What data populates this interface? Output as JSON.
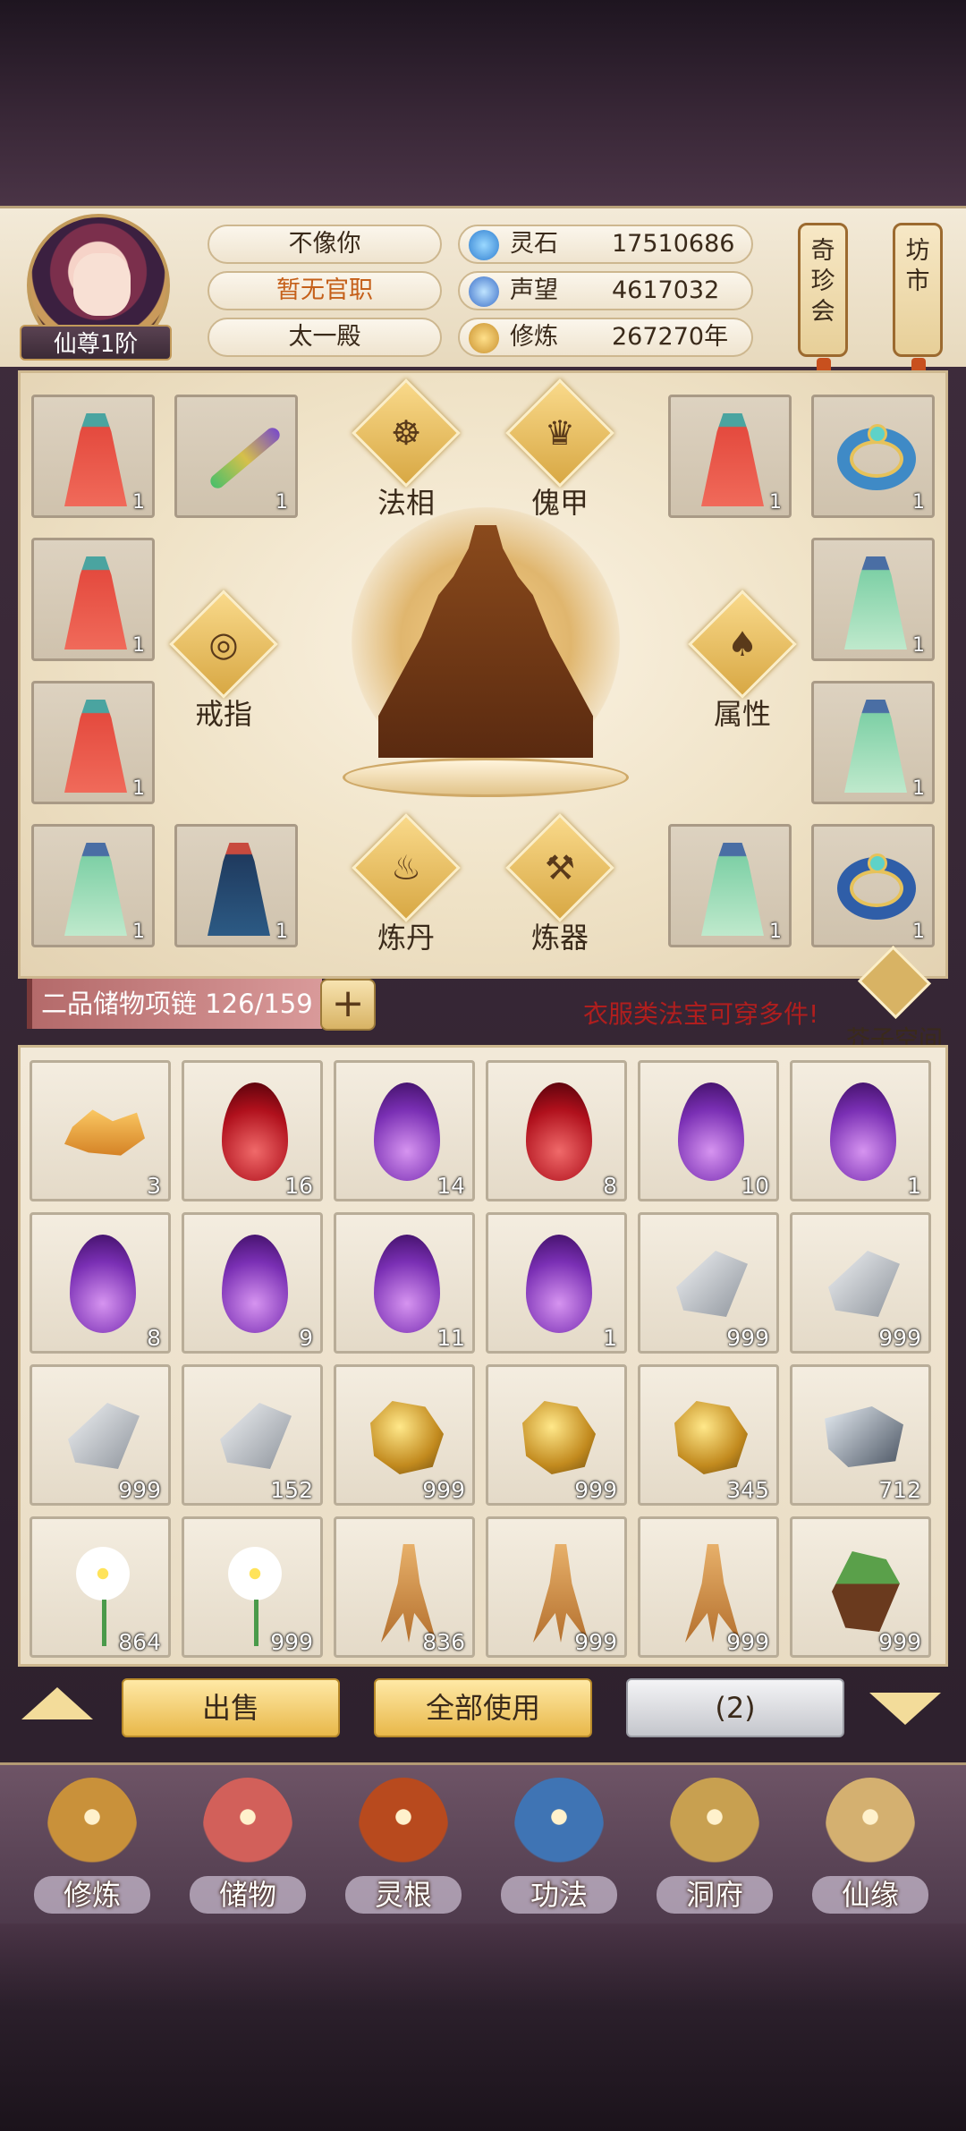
{
  "player": {
    "rank": "仙尊1阶",
    "name": "不像你",
    "official_post": "暂无官职",
    "sect": "太一殿"
  },
  "resources": [
    {
      "icon": "spirit-stone-icon",
      "label": "灵石",
      "value": "17510686"
    },
    {
      "icon": "reputation-icon",
      "label": "声望",
      "value": "4617032"
    },
    {
      "icon": "cultivation-icon",
      "label": "修炼",
      "value": "267270年"
    }
  ],
  "side_buttons": [
    {
      "label": "奇珍会"
    },
    {
      "label": "坊市"
    }
  ],
  "equipment": {
    "left_slots": [
      {
        "item": "red-robe",
        "count": "1"
      },
      {
        "item": "sword",
        "count": "1"
      },
      {
        "item": "red-robe",
        "count": "1"
      },
      {
        "item": "red-robe",
        "count": "1"
      },
      {
        "item": "green-robe",
        "count": "1"
      },
      {
        "item": "blue-robe",
        "count": "1"
      }
    ],
    "right_slots": [
      {
        "item": "red-robe",
        "count": "1"
      },
      {
        "item": "gold-ring",
        "count": "1"
      },
      {
        "item": "green-robe",
        "count": "1"
      },
      {
        "item": "green-robe",
        "count": "1"
      },
      {
        "item": "green-robe",
        "count": "1"
      },
      {
        "item": "blue-ring",
        "count": "1"
      }
    ],
    "buttons": {
      "faxiang": "法相",
      "kuijia": "傀甲",
      "jiezhi": "戒指",
      "shuxing": "属性",
      "liandan": "炼丹",
      "lianqi": "炼器"
    }
  },
  "storage": {
    "label": "二品储物项链",
    "capacity": "126/159",
    "plus": "+",
    "tip": "衣服类法宝可穿多件!",
    "jiezi": "芥子空间"
  },
  "inventory": [
    {
      "type": "ore",
      "count": "3"
    },
    {
      "type": "flame-red",
      "count": "16"
    },
    {
      "type": "flame-purple",
      "count": "14"
    },
    {
      "type": "flame-red",
      "count": "8"
    },
    {
      "type": "flame-purple",
      "count": "10"
    },
    {
      "type": "flame-purple",
      "count": "1"
    },
    {
      "type": "flame-purple",
      "count": "8"
    },
    {
      "type": "flame-purple",
      "count": "9"
    },
    {
      "type": "flame-purple",
      "count": "11"
    },
    {
      "type": "flame-purple",
      "count": "1"
    },
    {
      "type": "stone",
      "count": "999"
    },
    {
      "type": "stone",
      "count": "999"
    },
    {
      "type": "stone",
      "count": "999"
    },
    {
      "type": "stone",
      "count": "152"
    },
    {
      "type": "gold",
      "count": "999"
    },
    {
      "type": "gold",
      "count": "999"
    },
    {
      "type": "gold",
      "count": "345"
    },
    {
      "type": "iron",
      "count": "712"
    },
    {
      "type": "lily",
      "count": "864"
    },
    {
      "type": "lily",
      "count": "999"
    },
    {
      "type": "ginseng",
      "count": "836"
    },
    {
      "type": "ginseng",
      "count": "999"
    },
    {
      "type": "ginseng",
      "count": "999"
    },
    {
      "type": "herb",
      "count": "999"
    }
  ],
  "actions": {
    "sell": "出售",
    "use_all": "全部使用",
    "page": "(2)"
  },
  "nav": [
    {
      "label": "修炼",
      "icon": "cultivate-icon",
      "color": "#c9913a"
    },
    {
      "label": "储物",
      "icon": "storage-bag-icon",
      "color": "#d2605a"
    },
    {
      "label": "灵根",
      "icon": "spirit-root-icon",
      "color": "#b84a1e"
    },
    {
      "label": "功法",
      "icon": "manual-book-icon",
      "color": "#3f74b4"
    },
    {
      "label": "洞府",
      "icon": "cave-house-icon",
      "color": "#c8a050"
    },
    {
      "label": "仙缘",
      "icon": "immortal-fate-icon",
      "color": "#d4b070"
    }
  ]
}
